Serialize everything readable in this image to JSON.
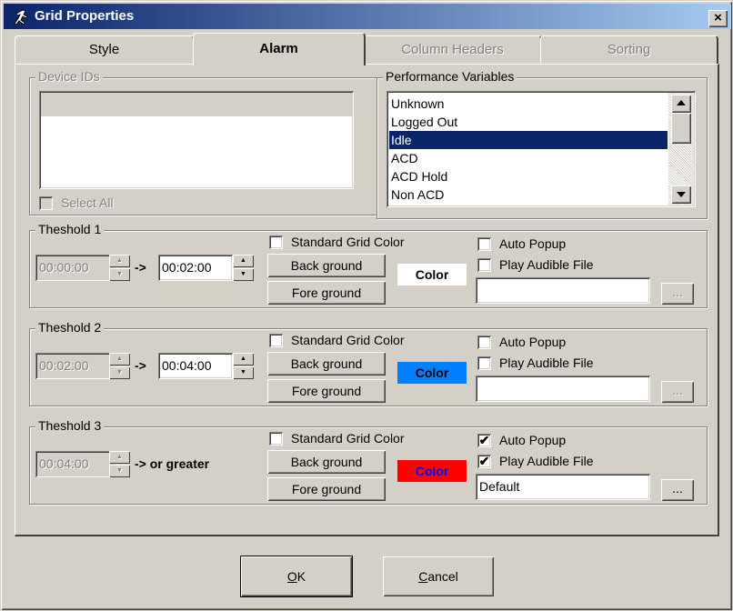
{
  "window": {
    "title": "Grid Properties",
    "close_glyph": "×"
  },
  "tabs": [
    {
      "label": "Style",
      "active": false,
      "enabled": true
    },
    {
      "label": "Alarm",
      "active": true,
      "enabled": true
    },
    {
      "label": "Column Headers",
      "active": false,
      "enabled": false
    },
    {
      "label": "Sorting",
      "active": false,
      "enabled": false
    }
  ],
  "device_ids": {
    "legend": "Device IDs",
    "select_all_label": "Select All",
    "select_all_checked": false,
    "enabled": false
  },
  "performance_variables": {
    "legend": "Performance Variables",
    "items": [
      "Unknown",
      "Logged Out",
      "Idle",
      "ACD",
      "ACD Hold",
      "Non ACD"
    ],
    "selected": "Idle"
  },
  "thresholds": [
    {
      "legend": "Theshold 1",
      "from": "00:00:00",
      "arrow": "->",
      "to": "00:02:00",
      "or_greater": "",
      "standard_grid_color_label": "Standard Grid Color",
      "standard_grid_color": false,
      "back_ground_label": "Back ground",
      "fore_ground_label": "Fore ground",
      "color_label": "Color",
      "color_bg": "#ffffff",
      "color_fg": "#000000",
      "auto_popup_label": "Auto Popup",
      "auto_popup": false,
      "play_audible_label": "Play Audible File",
      "play_audible": false,
      "audible_file": "",
      "browse_label": "..."
    },
    {
      "legend": "Theshold 2",
      "from": "00:02:00",
      "arrow": "->",
      "to": "00:04:00",
      "or_greater": "",
      "standard_grid_color_label": "Standard Grid Color",
      "standard_grid_color": false,
      "back_ground_label": "Back ground",
      "fore_ground_label": "Fore ground",
      "color_label": "Color",
      "color_bg": "#0080ff",
      "color_fg": "#000000",
      "auto_popup_label": "Auto Popup",
      "auto_popup": false,
      "play_audible_label": "Play Audible File",
      "play_audible": false,
      "audible_file": "",
      "browse_label": "..."
    },
    {
      "legend": "Theshold 3",
      "from": "00:04:00",
      "arrow": "->",
      "to": "",
      "or_greater": "-> or greater",
      "standard_grid_color_label": "Standard Grid Color",
      "standard_grid_color": false,
      "back_ground_label": "Back ground",
      "fore_ground_label": "Fore ground",
      "color_label": "Color",
      "color_bg": "#ff0000",
      "color_fg": "#0000ff",
      "auto_popup_label": "Auto Popup",
      "auto_popup": true,
      "play_audible_label": "Play Audible File",
      "play_audible": true,
      "audible_file": "Default",
      "browse_label": "..."
    }
  ],
  "buttons": {
    "ok": "OK",
    "ok_accel": "O",
    "cancel": "Cancel",
    "cancel_accel": "C"
  },
  "check_glyph": "✔",
  "icons": {
    "app": "running-figure-icon",
    "close": "close-icon",
    "scroll_up": "arrow-up-icon",
    "scroll_down": "arrow-down-icon",
    "spin_up": "spin-up-icon",
    "spin_down": "spin-down-icon"
  }
}
